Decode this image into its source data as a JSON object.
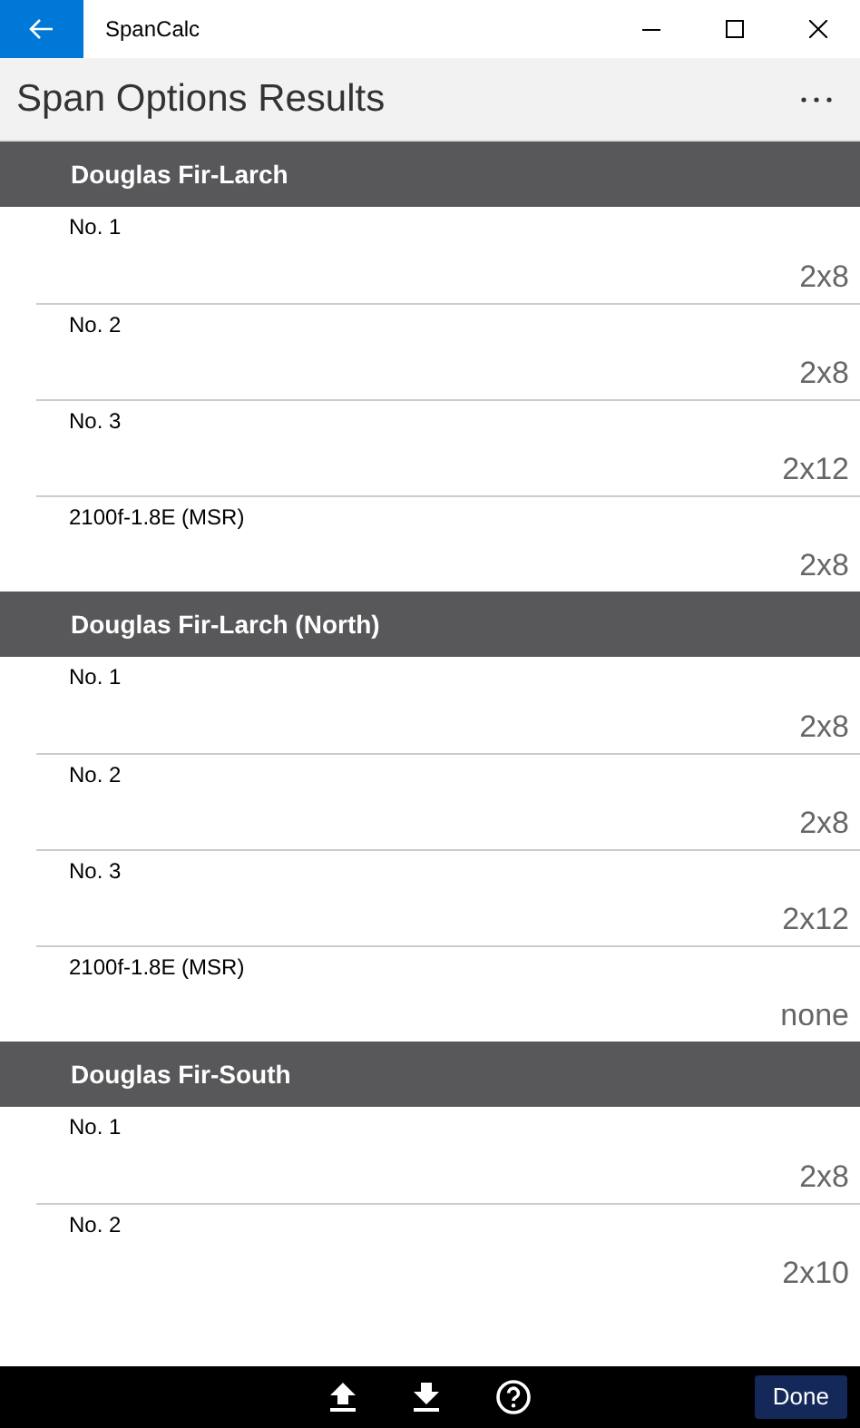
{
  "window": {
    "title": "SpanCalc"
  },
  "page_title": "Span Options Results",
  "groups": [
    {
      "name": "Douglas Fir-Larch",
      "rows": [
        {
          "grade": "No. 1",
          "size": "2x8"
        },
        {
          "grade": "No. 2",
          "size": "2x8"
        },
        {
          "grade": "No. 3",
          "size": "2x12"
        },
        {
          "grade": "2100f-1.8E (MSR)",
          "size": "2x8"
        }
      ]
    },
    {
      "name": "Douglas Fir-Larch (North)",
      "rows": [
        {
          "grade": "No. 1",
          "size": "2x8"
        },
        {
          "grade": "No. 2",
          "size": "2x8"
        },
        {
          "grade": "No. 3",
          "size": "2x12"
        },
        {
          "grade": "2100f-1.8E (MSR)",
          "size": "none"
        }
      ]
    },
    {
      "name": "Douglas Fir-South",
      "rows": [
        {
          "grade": "No. 1",
          "size": "2x8"
        },
        {
          "grade": "No. 2",
          "size": "2x10"
        }
      ]
    }
  ],
  "done_button": "Done"
}
